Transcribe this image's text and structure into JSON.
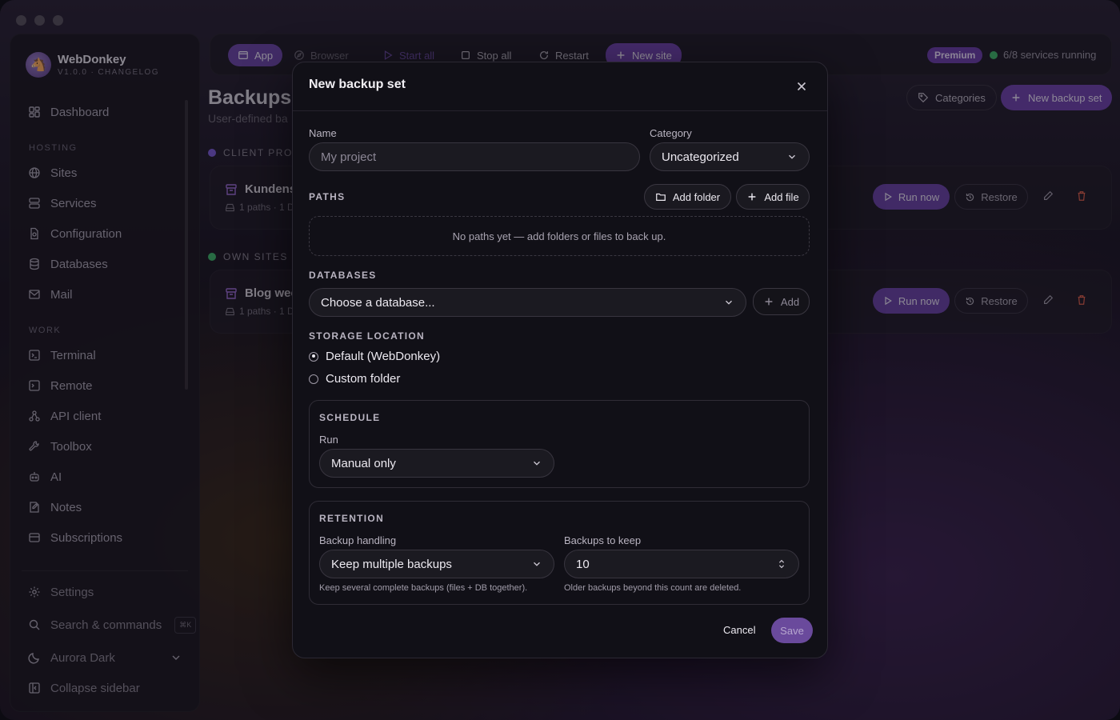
{
  "sidebar": {
    "brand_name": "WebDonkey",
    "brand_sub": "V1.0.0 · CHANGELOG",
    "dashboard": "Dashboard",
    "hosting_label": "HOSTING",
    "hosting_items": [
      "Sites",
      "Services",
      "Configuration",
      "Databases",
      "Mail"
    ],
    "work_label": "WORK",
    "work_items": [
      "Terminal",
      "Remote",
      "API client",
      "Toolbox",
      "AI",
      "Notes",
      "Subscriptions"
    ],
    "settings": "Settings",
    "search": "Search & commands",
    "search_kbd": "⌘K",
    "theme": "Aurora Dark",
    "collapse": "Collapse sidebar"
  },
  "toolbar": {
    "app": "App",
    "browser": "Browser",
    "start_all": "Start all",
    "stop_all": "Stop all",
    "restart": "Restart",
    "new_site": "New site",
    "premium": "Premium",
    "status": "6/8 services running"
  },
  "page": {
    "title": "Backups",
    "subtitle": "User-defined ba",
    "categories_btn": "Categories",
    "new_backup_btn": "New backup set",
    "sections": [
      {
        "label": "CLIENT PROJE",
        "color": "#7b5cd6",
        "card_title": "Kundens",
        "card_meta": "1 paths · 1 D"
      },
      {
        "label": "OWN SITES",
        "color": "#3fb36a",
        "card_title": "Blog wee",
        "card_meta": "1 paths · 1 D"
      }
    ],
    "run_now": "Run now",
    "restore": "Restore"
  },
  "modal": {
    "title": "New backup set",
    "name_label": "Name",
    "name_placeholder": "My project",
    "category_label": "Category",
    "category_value": "Uncategorized",
    "paths_label": "PATHS",
    "add_folder": "Add folder",
    "add_file": "Add file",
    "paths_empty": "No paths yet — add folders or files to back up.",
    "databases_label": "DATABASES",
    "database_placeholder": "Choose a database...",
    "db_add": "Add",
    "storage_label": "STORAGE LOCATION",
    "storage_default": "Default (WebDonkey)",
    "storage_custom": "Custom folder",
    "schedule_label": "SCHEDULE",
    "run_label": "Run",
    "run_value": "Manual only",
    "retention_label": "RETENTION",
    "handling_label": "Backup handling",
    "handling_value": "Keep multiple backups",
    "handling_hint": "Keep several complete backups (files + DB together).",
    "keep_label": "Backups to keep",
    "keep_value": "10",
    "keep_hint": "Older backups beyond this count are deleted.",
    "cancel": "Cancel",
    "save": "Save"
  }
}
